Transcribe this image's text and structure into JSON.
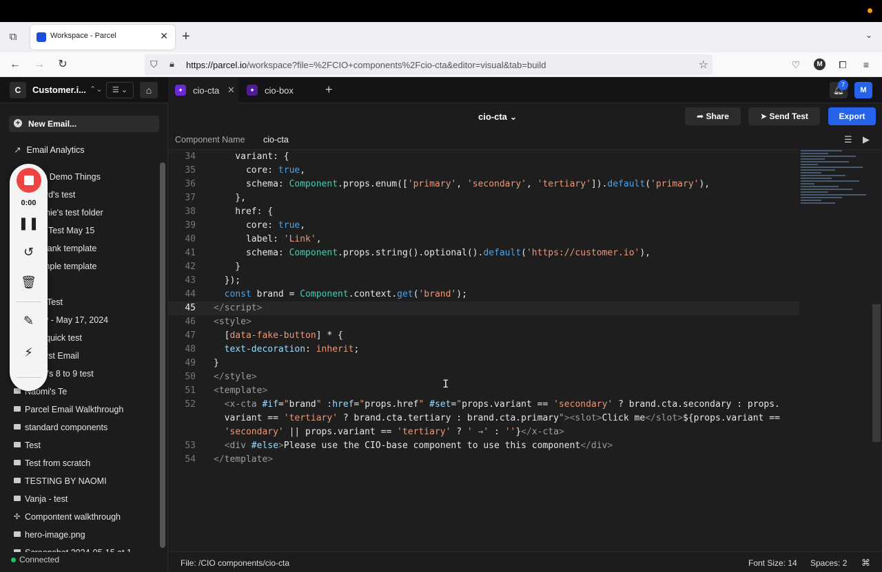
{
  "browser": {
    "tab_title": "Workspace - Parcel",
    "url_host": "https://parcel.io",
    "url_path": "/workspace?file=%2FCIO+components%2Fcio-cta&editor=visual&tab=build",
    "profile_initial": "M"
  },
  "app": {
    "workspace_initial": "C",
    "workspace_name": "Customer.i...",
    "tabs": [
      {
        "label": "cio-cta"
      },
      {
        "label": "cio-box"
      }
    ],
    "notification_count": "7",
    "user_initial": "M"
  },
  "sidebar": {
    "new_email": "New Email...",
    "analytics": "Email Analytics",
    "items": [
      {
        "label": "s Demo Things",
        "icon": "folder"
      },
      {
        "label": "rd's test",
        "icon": "folder"
      },
      {
        "label": "nie's test folder",
        "icon": "folder"
      },
      {
        "label": "Test May 15",
        "icon": "folder"
      },
      {
        "label": "lank template",
        "icon": "folder"
      },
      {
        "label": "mple template",
        "icon": "folder"
      },
      {
        "label": "Test",
        "icon": "folder"
      },
      {
        "label": "y - May 17, 2024",
        "icon": "folder"
      },
      {
        "label": "quick test",
        "icon": "folder"
      },
      {
        "label": "rst Email",
        "icon": "folder"
      },
      {
        "label": "i's 8 to 9 test",
        "icon": "folder"
      },
      {
        "label": "Naomi's Te",
        "icon": "mail"
      },
      {
        "label": "Parcel Email Walkthrough",
        "icon": "mail"
      },
      {
        "label": "standard components",
        "icon": "mail"
      },
      {
        "label": "Test",
        "icon": "mail"
      },
      {
        "label": "Test from scratch",
        "icon": "mail"
      },
      {
        "label": "TESTING BY NAOMI",
        "icon": "mail"
      },
      {
        "label": "Vanja - test",
        "icon": "mail"
      },
      {
        "label": "Compontent walkthrough",
        "icon": "component"
      },
      {
        "label": "hero-image.png",
        "icon": "image"
      },
      {
        "label": "Screenshot 2024-05-15 at 1",
        "icon": "image"
      }
    ],
    "connected": "Connected"
  },
  "recorder": {
    "time": "0:00"
  },
  "editor": {
    "file_title": "cio-cta",
    "share": "Share",
    "send_test": "Send Test",
    "export": "Export",
    "component_name_label": "Component Name",
    "component_name_value": "cio-cta",
    "current_line": 45
  },
  "status": {
    "file": "File: /CIO components/cio-cta",
    "font_size": "Font Size: 14",
    "spaces": "Spaces: 2",
    "cmd": "⌘"
  },
  "colors": {
    "accent": "#2563eb",
    "recording": "#ef4444",
    "connected": "#22c55e"
  }
}
